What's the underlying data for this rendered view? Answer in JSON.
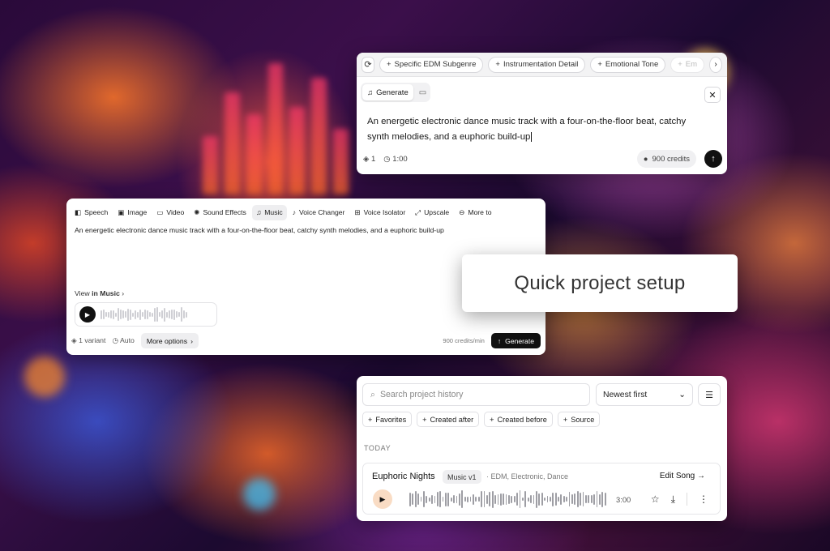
{
  "top_prompt": {
    "suggestions": [
      "Specific EDM Subgenre",
      "Instrumentation Detail",
      "Emotional Tone",
      "Em"
    ],
    "mode_label": "Generate",
    "prompt_text": "An energetic electronic dance music track with a four-on-the-floor beat, catchy synth melodies, and a euphoric build-up",
    "variants": "1",
    "duration": "1:00",
    "credits": "900 credits",
    "icons": [
      "refresh-icon",
      "plus-icon",
      "chevron-right-icon",
      "music-note-icon",
      "video-icon",
      "close-icon",
      "layers-icon",
      "clock-icon",
      "coin-icon",
      "arrow-up-icon"
    ]
  },
  "studio": {
    "tabs": [
      {
        "label": "Speech",
        "icon": "speech-icon"
      },
      {
        "label": "Image",
        "icon": "image-icon"
      },
      {
        "label": "Video",
        "icon": "video-icon"
      },
      {
        "label": "Sound Effects",
        "icon": "sound-effects-icon"
      },
      {
        "label": "Music",
        "icon": "music-note-icon",
        "active": true
      },
      {
        "label": "Voice Changer",
        "icon": "voice-changer-icon"
      },
      {
        "label": "Voice Isolator",
        "icon": "voice-isolator-icon"
      },
      {
        "label": "Upscale",
        "icon": "upscale-icon"
      },
      {
        "label": "More to",
        "icon": "more-icon"
      }
    ],
    "prompt_text": "An energetic electronic dance music track with a four-on-the-floor beat, catchy synth melodies, and a euphoric build-up",
    "view_prefix": "View ",
    "view_strong": "in Music",
    "variants": "1 variant",
    "auto": "Auto",
    "more_options": "More options",
    "rate": "900 credits/min",
    "generate": "Generate"
  },
  "label_card": {
    "text": "Quick project setup"
  },
  "history": {
    "search_placeholder": "Search project history",
    "sort": "Newest first",
    "filters": [
      "Favorites",
      "Created after",
      "Created before",
      "Source"
    ],
    "section": "TODAY",
    "song": {
      "title": "Euphoric Nights",
      "badge": "Music v1",
      "tags": "· EDM, Electronic, Dance",
      "edit": "Edit Song →",
      "duration": "3:00"
    }
  },
  "colors": {
    "dark_button": "#111111",
    "play_peach": "#f9dcc4",
    "card_bg": "#ffffff"
  }
}
